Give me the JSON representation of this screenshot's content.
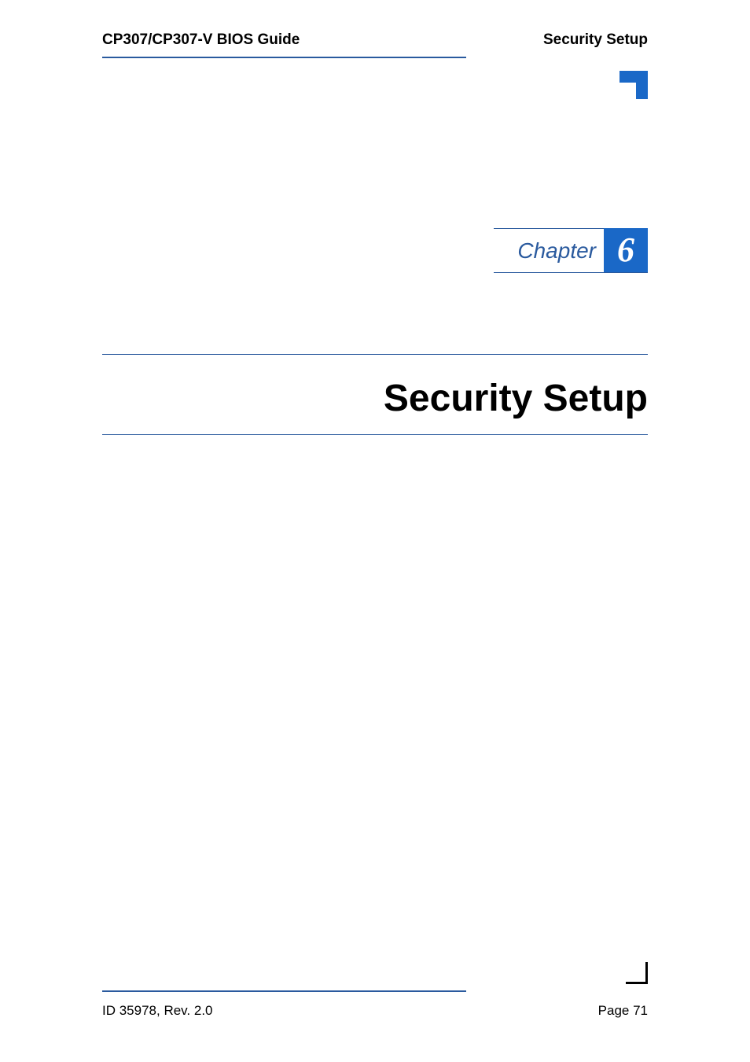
{
  "header": {
    "left": "CP307/CP307-V BIOS Guide",
    "right": "Security Setup"
  },
  "chapter": {
    "label": "Chapter",
    "number": "6"
  },
  "title": "Security Setup",
  "footer": {
    "left": "ID 35978, Rev. 2.0",
    "right": "Page 71"
  },
  "colors": {
    "accent": "#2a5a9e",
    "chapter_box": "#1a68c7"
  }
}
